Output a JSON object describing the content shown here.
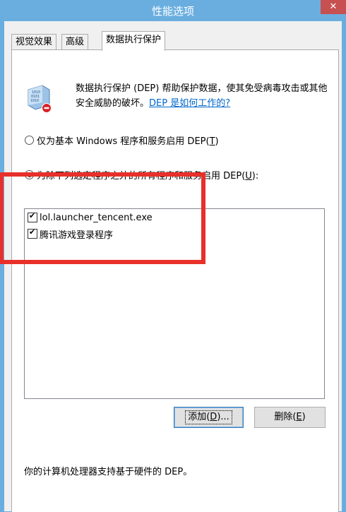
{
  "window": {
    "title": "性能选项",
    "close_label": "✕"
  },
  "tabs": [
    {
      "label": "视觉效果"
    },
    {
      "label": "高级"
    },
    {
      "label": "数据执行保护",
      "active": true
    }
  ],
  "dep": {
    "icon": "dep-shield-icon",
    "description": "数据执行保护 (DEP) 帮助保护数据，使其免受病毒攻击或其他安全威胁的破坏。",
    "help_link": "DEP 是如何工作的?",
    "options": [
      {
        "prefix": "仅为基本 Windows 程序和服务启用 DEP(",
        "key": "T",
        "suffix": ")",
        "checked": false
      },
      {
        "prefix": "为除下列选定程序之外的所有程序和服务启用 DEP(",
        "key": "U",
        "suffix": "):",
        "checked": true
      }
    ],
    "programs": [
      {
        "name": "lol.launcher_tencent.exe",
        "checked": true
      },
      {
        "name": "腾讯游戏登录程序",
        "checked": true
      }
    ],
    "add_button": {
      "prefix": "添加(",
      "key": "D",
      "suffix": ")..."
    },
    "remove_button": {
      "prefix": "删除(",
      "key": "E",
      "suffix": ")"
    },
    "hardware_note": "你的计算机处理器支持基于硬件的 DEP。"
  },
  "colors": {
    "titlebar": "#6aaee0",
    "highlight": "#e8302a",
    "link": "#0066cc"
  }
}
